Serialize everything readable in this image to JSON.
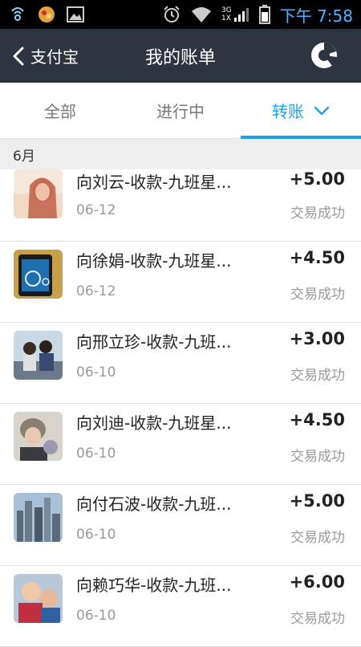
{
  "status_bar": {
    "network": "3G",
    "network2": "1X",
    "time": "下午 7:58"
  },
  "header": {
    "back_label": "支付宝",
    "title": "我的账单"
  },
  "tabs": [
    {
      "label": "全部",
      "active": false
    },
    {
      "label": "进行中",
      "active": false
    },
    {
      "label": "转账",
      "active": true
    }
  ],
  "section_label": "6月",
  "bills": [
    {
      "title": "向刘云-收款-九班星...",
      "date": "06-12",
      "amount": "+5.00",
      "status": "交易成功"
    },
    {
      "title": "向徐娟-收款-九班星...",
      "date": "06-12",
      "amount": "+4.50",
      "status": "交易成功"
    },
    {
      "title": "向邢立珍-收款-九班...",
      "date": "06-10",
      "amount": "+3.00",
      "status": "交易成功"
    },
    {
      "title": "向刘迪-收款-九班星...",
      "date": "06-10",
      "amount": "+4.50",
      "status": "交易成功"
    },
    {
      "title": "向付石波-收款-九班...",
      "date": "06-10",
      "amount": "+5.00",
      "status": "交易成功"
    },
    {
      "title": "向赖巧华-收款-九班...",
      "date": "06-10",
      "amount": "+6.00",
      "status": "交易成功"
    }
  ],
  "colors": {
    "accent": "#1ea1e8",
    "header_bg": "#2e3440",
    "time": "#4fb3ff"
  }
}
